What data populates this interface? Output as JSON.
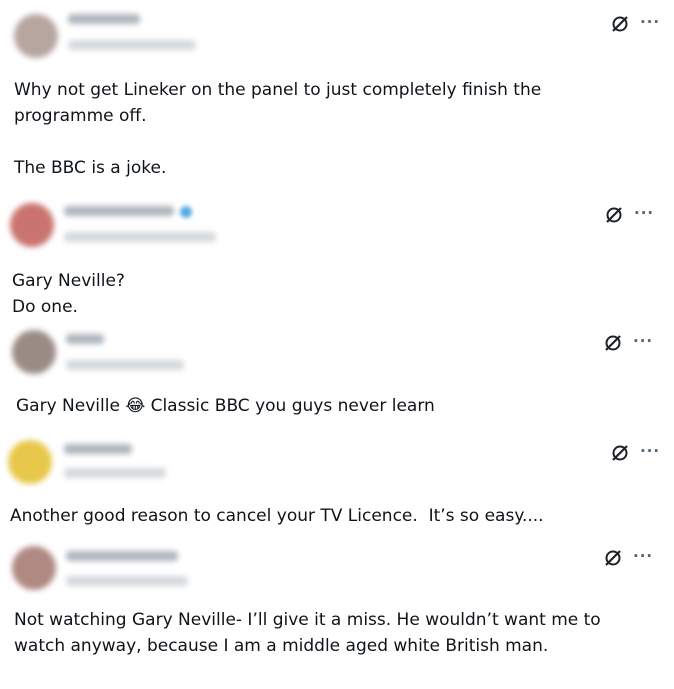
{
  "posts": [
    {
      "avatar_color": "#b7a59f",
      "text": "Why not get Lineker on the panel to just completely finish the\nprogramme off.\n\nThe BBC is a joke.",
      "has_badge": false
    },
    {
      "avatar_color": "#c9746f",
      "text": "Gary Neville?\nDo one.",
      "has_badge": true
    },
    {
      "avatar_color": "#9a8c85",
      "text": "Gary Neville 😂 Classic BBC you guys never learn",
      "has_badge": false
    },
    {
      "avatar_color": "#e8c84a",
      "text": "Another good reason to cancel your TV Licence.  It’s so easy....",
      "has_badge": false
    },
    {
      "avatar_color": "#b08a82",
      "text": "Not watching Gary Neville- I’ll give it a miss. He wouldn’t want me to\nwatch anyway, because I am a middle aged white British man.",
      "has_badge": false
    }
  ],
  "icons": {
    "grok": "grok-icon",
    "more": "more-icon"
  },
  "more_label": "···"
}
